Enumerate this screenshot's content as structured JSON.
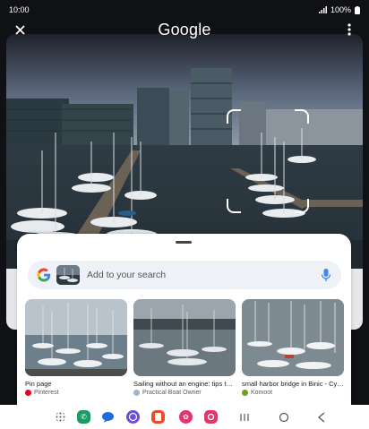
{
  "status_bar": {
    "time": "10:00",
    "battery": "100%"
  },
  "top_bar": {
    "title": "Google"
  },
  "search": {
    "placeholder": "Add to your search"
  },
  "results": [
    {
      "title": "Pin page",
      "source": "Pinterest",
      "source_color": "#e60023"
    },
    {
      "title": "Sailing without an engine: tips t…",
      "source": "Practical Boat Owner",
      "source_color": "#9fb7c9"
    },
    {
      "title": "small harbor bridge in Binic - Cy…",
      "source": "Komoot",
      "source_color": "#6aa127"
    }
  ],
  "dock_apps": [
    {
      "name": "apps-grid"
    },
    {
      "name": "phone",
      "color": "#1a9b63"
    },
    {
      "name": "messages",
      "color": "#1e6be0"
    },
    {
      "name": "internet",
      "color": "#6a4ce0"
    },
    {
      "name": "notes",
      "color": "#f04a2a"
    },
    {
      "name": "flower",
      "color": "#e0366a"
    },
    {
      "name": "camera",
      "color": "#e0366a"
    }
  ]
}
